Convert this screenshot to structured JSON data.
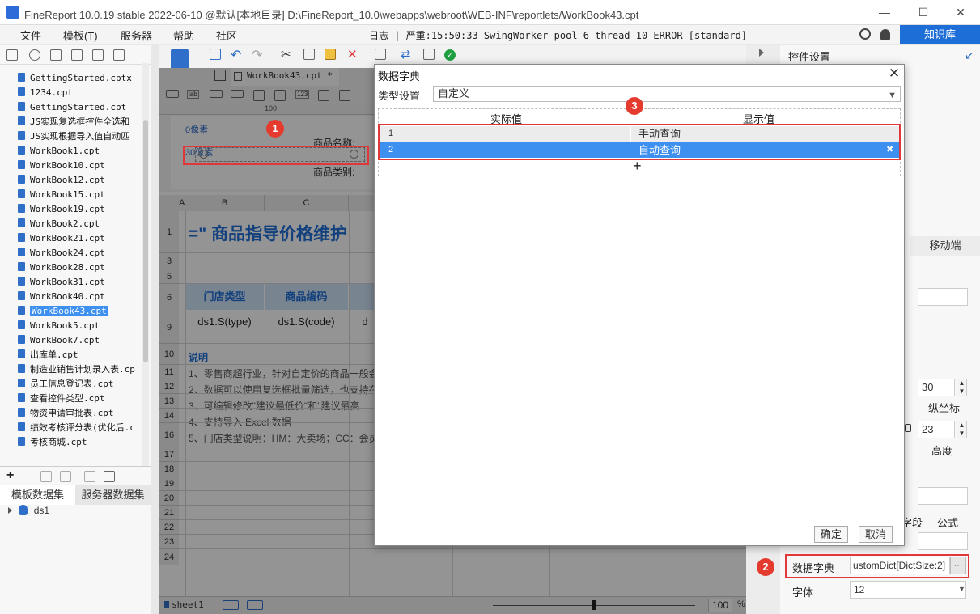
{
  "window": {
    "title": "FineReport 10.0.19 stable 2022-06-10 @默认[本地目录]    D:\\FineReport_10.0\\webapps\\webroot\\WEB-INF\\reportlets/WorkBook43.cpt",
    "minimize": "—",
    "maximize": "☐",
    "close": "✕"
  },
  "menu": {
    "items": [
      "文件",
      "模板(T)",
      "服务器",
      "帮助",
      "社区"
    ],
    "log": "日志 | 严重:15:50:33 SwingWorker-pool-6-thread-10 ERROR [standard]",
    "knowledge": "知识库"
  },
  "files": [
    "GettingStarted.cptx",
    "1234.cpt",
    "GettingStarted.cpt",
    "JS实现复选框控件全选和",
    "JS实现根据导入值自动匹",
    "WorkBook1.cpt",
    "WorkBook10.cpt",
    "WorkBook12.cpt",
    "WorkBook15.cpt",
    "WorkBook19.cpt",
    "WorkBook2.cpt",
    "WorkBook21.cpt",
    "WorkBook24.cpt",
    "WorkBook28.cpt",
    "WorkBook31.cpt",
    "WorkBook40.cpt",
    "WorkBook43.cpt",
    "WorkBook5.cpt",
    "WorkBook7.cpt",
    "出库单.cpt",
    "制造业销售计划录入表.cp",
    "员工信息登记表.cpt",
    "查看控件类型.cpt",
    "物资申请审批表.cpt",
    "绩效考核评分表(优化后.c",
    "考核商城.cpt"
  ],
  "selected_file": "WorkBook43.cpt",
  "datasets": {
    "tab_template": "模板数据集",
    "tab_server": "服务器数据集",
    "tree_item": "ds1"
  },
  "editor": {
    "tab": "WorkBook43.cpt *",
    "ruler_mark": "100",
    "form": {
      "px0": "0像素",
      "px30": "30像素",
      "label_name": "商品名称:",
      "label_type": "商品类别:"
    },
    "columns": [
      "A",
      "B",
      "C"
    ],
    "rows": [
      "1",
      "3",
      "5",
      "6",
      "9",
      "10",
      "11",
      "12",
      "13",
      "14",
      "16",
      "17",
      "18",
      "19",
      "20",
      "21",
      "22",
      "23",
      "24"
    ],
    "big_title": "=\"  商品指导价格维护",
    "header_cells": [
      "门店类型",
      "商品编码"
    ],
    "data_cells": [
      "ds1.S(type)",
      "ds1.S(code)",
      "d"
    ],
    "notes": [
      "说明",
      "1、零售商超行业，针对自定价的商品一般会",
      "2、数据可以使用复选框批量筛选，也支持在",
      "3、可编辑修改\"建议最低价\"和\"建议最高",
      "4、支持导入 Excel 数据",
      "5、门店类型说明：HM：大卖场；CC：会员"
    ],
    "sheet": "sheet1",
    "zoom": "100",
    "zoom_unit": "%"
  },
  "right_panel": {
    "title": "控件设置",
    "tab_mobile": "移动端",
    "field_30": "30",
    "label_y": "纵坐标",
    "field_23": "23",
    "label_height": "高度",
    "label_field": "字段",
    "label_formula": "公式",
    "dict_label": "数据字典",
    "dict_value": "ustomDict[DictSize:2]",
    "dict_btn": "···",
    "font_label": "字体",
    "font_value": "12"
  },
  "dialog": {
    "title": "数据字典",
    "close": "✕",
    "type_label": "类型设置",
    "type_value": "自定义",
    "col_actual": "实际值",
    "col_display": "显示值",
    "rows": [
      {
        "num": "1",
        "display": "手动查询"
      },
      {
        "num": "2",
        "display": "自动查询"
      }
    ],
    "add": "+",
    "ok": "确定",
    "cancel": "取消"
  },
  "badges": [
    "1",
    "2",
    "3"
  ]
}
